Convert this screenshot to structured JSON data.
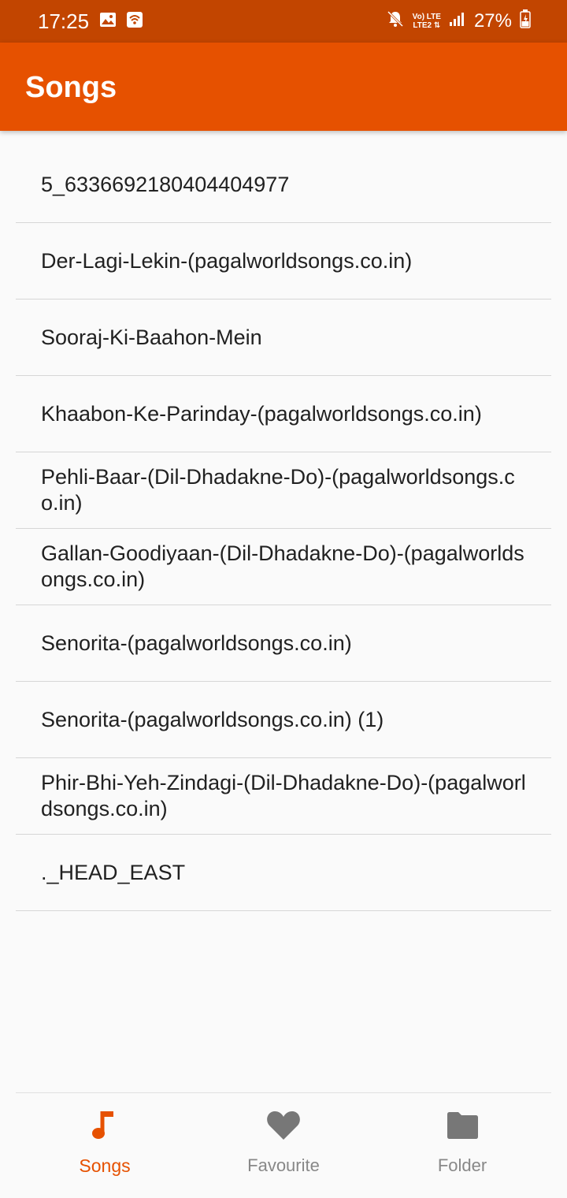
{
  "status_bar": {
    "time": "17:25",
    "battery": "27%",
    "lte_top": "Vo) LTE",
    "lte_bottom": "LTE2 ⇅",
    "icons": [
      "image-icon",
      "wifi-calling-icon",
      "mute-icon",
      "signal-icon",
      "battery-icon"
    ]
  },
  "app_bar": {
    "title": "Songs"
  },
  "songs": [
    "5_6336692180404404977",
    "Der-Lagi-Lekin-(pagalworldsongs.co.in)",
    "Sooraj-Ki-Baahon-Mein",
    "Khaabon-Ke-Parinday-(pagalworldsongs.co.in)",
    "Pehli-Baar-(Dil-Dhadakne-Do)-(pagalworldsongs.co.in)",
    "Gallan-Goodiyaan-(Dil-Dhadakne-Do)-(pagalworldsongs.co.in)",
    "Senorita-(pagalworldsongs.co.in)",
    "Senorita-(pagalworldsongs.co.in) (1)",
    "Phir-Bhi-Yeh-Zindagi-(Dil-Dhadakne-Do)-(pagalworldsongs.co.in)",
    "._HEAD_EAST"
  ],
  "bottom_nav": {
    "items": [
      {
        "label": "Songs",
        "icon": "music-note-icon",
        "active": true
      },
      {
        "label": "Favourite",
        "icon": "heart-icon",
        "active": false
      },
      {
        "label": "Folder",
        "icon": "folder-icon",
        "active": false
      }
    ]
  },
  "colors": {
    "status_bar": "#c24500",
    "app_bar": "#e65100",
    "accent": "#e65100",
    "inactive": "#888888"
  }
}
